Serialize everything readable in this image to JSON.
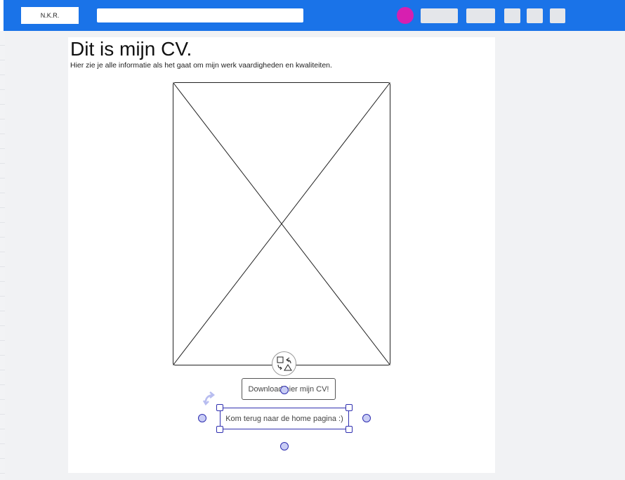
{
  "header": {
    "logo_text": "N.K.R.",
    "accent_color": "#1a73e8",
    "avatar_color": "#d71fb0"
  },
  "page": {
    "title": "Dit is mijn CV.",
    "subtitle": "Hier zie je alle informatie als het gaat om mijn werk vaardigheden en kwaliteiten."
  },
  "buttons": {
    "download_label": "Download hier mijn CV!",
    "home_label": "Kom terug naar de home pagina :)"
  },
  "icons": {
    "placeholder": "image-placeholder-icon",
    "shapes": "shapes-toolbar-icon",
    "rotate": "rotate-icon"
  }
}
